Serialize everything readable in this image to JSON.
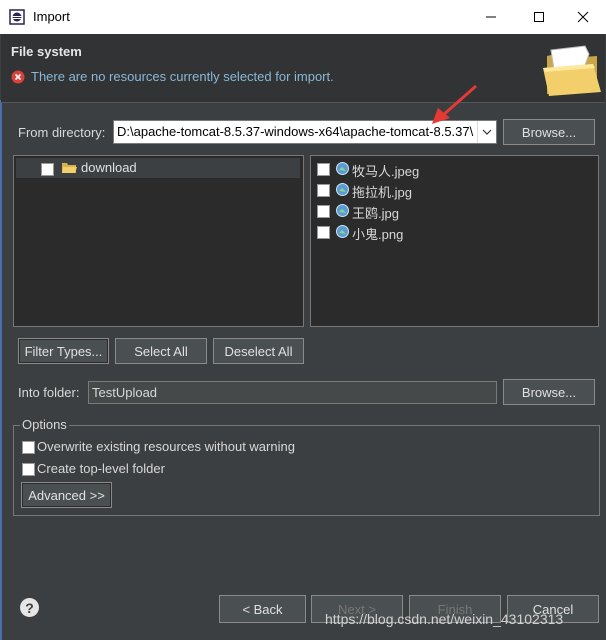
{
  "window": {
    "title": "Import",
    "controls": [
      "minimize-icon",
      "maximize-icon",
      "close-icon"
    ]
  },
  "banner": {
    "heading": "File system",
    "message": "There are no resources currently selected for import.",
    "error_icon": "error-x-icon",
    "image_icon": "open-folder-icon"
  },
  "from_directory": {
    "label": "From directory:",
    "value": "D:\\apache-tomcat-8.5.37-windows-x64\\apache-tomcat-8.5.37\\",
    "browse_label": "Browse..."
  },
  "tree": {
    "items": [
      {
        "label": "download",
        "checked": false,
        "icon": "folder-icon"
      }
    ]
  },
  "files": {
    "items": [
      {
        "name": "牧马人.jpeg",
        "checked": false,
        "icon": "image-file-icon"
      },
      {
        "name": "拖拉机.jpg",
        "checked": false,
        "icon": "image-file-icon"
      },
      {
        "name": "王鸥.jpg",
        "checked": false,
        "icon": "image-file-icon"
      },
      {
        "name": "小鬼.png",
        "checked": false,
        "icon": "image-file-icon"
      }
    ]
  },
  "selection_buttons": {
    "filter_types": "Filter Types...",
    "select_all": "Select All",
    "deselect_all": "Deselect All"
  },
  "into_folder": {
    "label": "Into folder:",
    "value": "TestUpload",
    "browse_label": "Browse..."
  },
  "options": {
    "legend": "Options",
    "overwrite_label": "Overwrite existing resources without warning",
    "overwrite_checked": false,
    "create_top_level_label": "Create top-level folder",
    "create_top_level_checked": false,
    "advanced_label": "Advanced >>"
  },
  "footer": {
    "help_icon": "help-icon",
    "back_label": "< Back",
    "next_label": "Next >",
    "finish_label": "Finish",
    "cancel_label": "Cancel"
  },
  "watermark": "https://blog.csdn.net/weixin_43102313",
  "colors": {
    "dialog_bg": "#3c3f41",
    "panel_bg": "#2b2b2b",
    "message_text": "#8ab8d6",
    "annotation_arrow": "#e53935"
  }
}
